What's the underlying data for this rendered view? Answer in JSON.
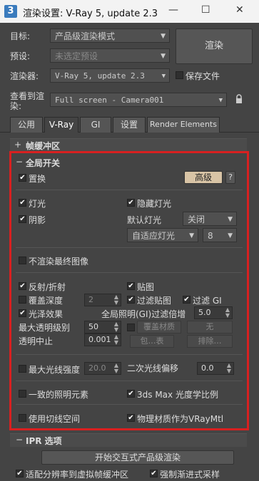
{
  "window": {
    "app_icon": "3",
    "title": "渲染设置: V-Ray 5, update 2.3",
    "minimize": "—",
    "maximize": "☐",
    "close": "✕"
  },
  "header": {
    "target_label": "目标:",
    "target_value": "产品级渲染模式",
    "preset_label": "预设:",
    "preset_value": "未选定预设",
    "renderer_label": "渲染器:",
    "renderer_value": "V-Ray 5, update 2.3",
    "save_file_label": "保存文件",
    "view_label_1": "查看到渲",
    "view_label_2": "染:",
    "view_value": "Full screen - Camera001",
    "render_button": "渲染"
  },
  "tabs": [
    "公用",
    "V-Ray",
    "GI",
    "设置",
    "Render Elements"
  ],
  "active_tab": 1,
  "rollups": {
    "frame_buffer": "帧缓冲区",
    "global_switches": "全局开关",
    "ipr": "IPR 选项"
  },
  "global": {
    "displacement": "置换",
    "advanced_button": "高级",
    "help_button": "?",
    "lights": "灯光",
    "hidden_lights": "隐藏灯光",
    "shadows": "阴影",
    "default_lights_label": "默认灯光",
    "default_lights_value": "关闭",
    "adaptive_lights_value": "自适应灯光",
    "adaptive_lights_count": "8",
    "dont_render_final": "不渲染最终图像",
    "reflection_refraction": "反射/折射",
    "maps": "贴图",
    "override_depth": "覆盖深度",
    "override_depth_value": "2",
    "filter_maps": "过滤贴图",
    "filter_gi": "过滤 GI",
    "glossy_effects": "光泽效果",
    "gi_filter_multiplier_label": "全局照明(GI)过滤倍增",
    "gi_filter_multiplier_value": "5.0",
    "max_transp_levels_label": "最大透明级别",
    "max_transp_levels_value": "50",
    "override_mtl": "覆盖材质",
    "override_mtl_button": "无",
    "transp_cutoff_label": "透明中止",
    "transp_cutoff_value": "0.001",
    "include_button": "包…表",
    "exclude_button": "排除…",
    "max_ray_intensity": "最大光线强度",
    "max_ray_intensity_value": "20.0",
    "secondary_ray_bias_label": "二次光线偏移",
    "secondary_ray_bias_value": "0.0",
    "consistent_lighting": "一致的照明元素",
    "photometric_scale": "3ds Max 光度学比例",
    "use_local_subdivs": "使用切线空间",
    "phys_mtl_as_vray": "物理材质作为VRayMtl"
  },
  "ipr": {
    "start_button": "开始交互式产品级渲染",
    "fit_resolution": "适配分辨率到虚拟帧缓冲区",
    "force_progressive": "强制渐进式采样"
  },
  "colors": {
    "highlight_box": "#d82020",
    "advanced_button_bg": "#d8c4a6"
  }
}
